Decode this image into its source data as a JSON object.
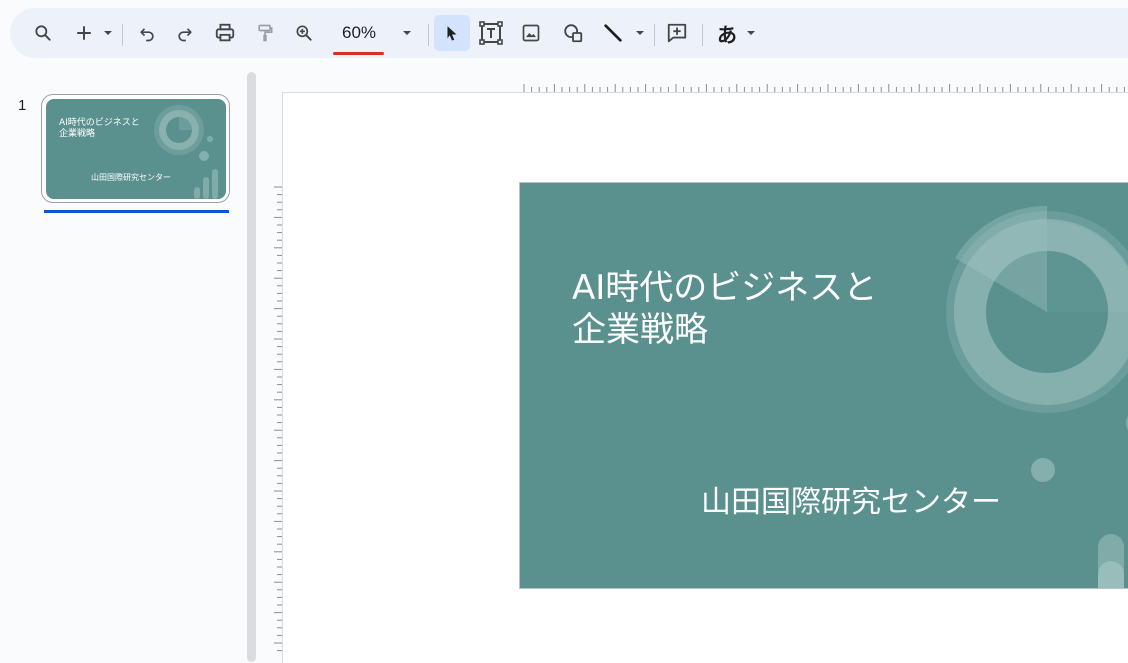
{
  "toolbar": {
    "zoom_value": "60%",
    "ime_label": "あ",
    "icons": [
      "search-icon",
      "add-icon",
      "undo-icon",
      "redo-icon",
      "print-icon",
      "paint-format-icon",
      "zoom-in-icon",
      "select-cursor-icon",
      "text-box-icon",
      "image-icon",
      "shapes-icon",
      "line-icon",
      "comment-add-icon"
    ]
  },
  "filmstrip": {
    "slides": [
      {
        "number": "1",
        "title_line1": "AI時代のビジネスと",
        "title_line2": "企業戦略",
        "subtitle": "山田国際研究センター"
      }
    ]
  },
  "slide": {
    "title_line1": "AI時代のビジネスと",
    "title_line2": "企業戦略",
    "subtitle": "山田国際研究センター",
    "background_color": "#5a918f"
  },
  "colors": {
    "toolbar_bg": "#edf2fa",
    "selection_bg": "#d3e3fd",
    "zoom_underline": "#d93025",
    "thumb_selected": "#0b57d0"
  }
}
